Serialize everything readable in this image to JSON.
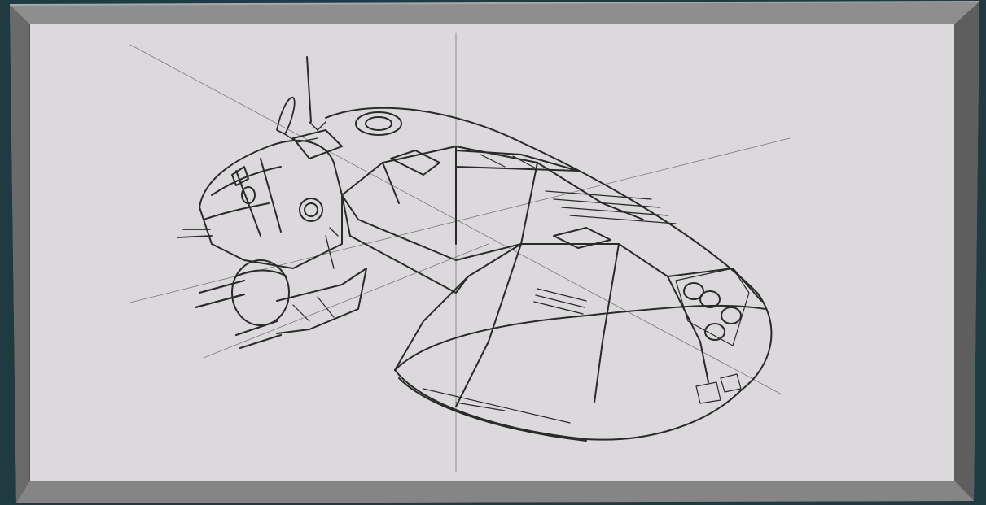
{
  "scene": {
    "type": "framed-sketch",
    "subject": "spaceship-concept-sketch",
    "colors": {
      "background": "#1f3a40",
      "frame": "#7b7b7b",
      "frame_light": "#9a9a9a",
      "frame_dark": "#4e4e4e",
      "canvas": "#dcd9dc",
      "ink": "#2a2a2a"
    }
  }
}
